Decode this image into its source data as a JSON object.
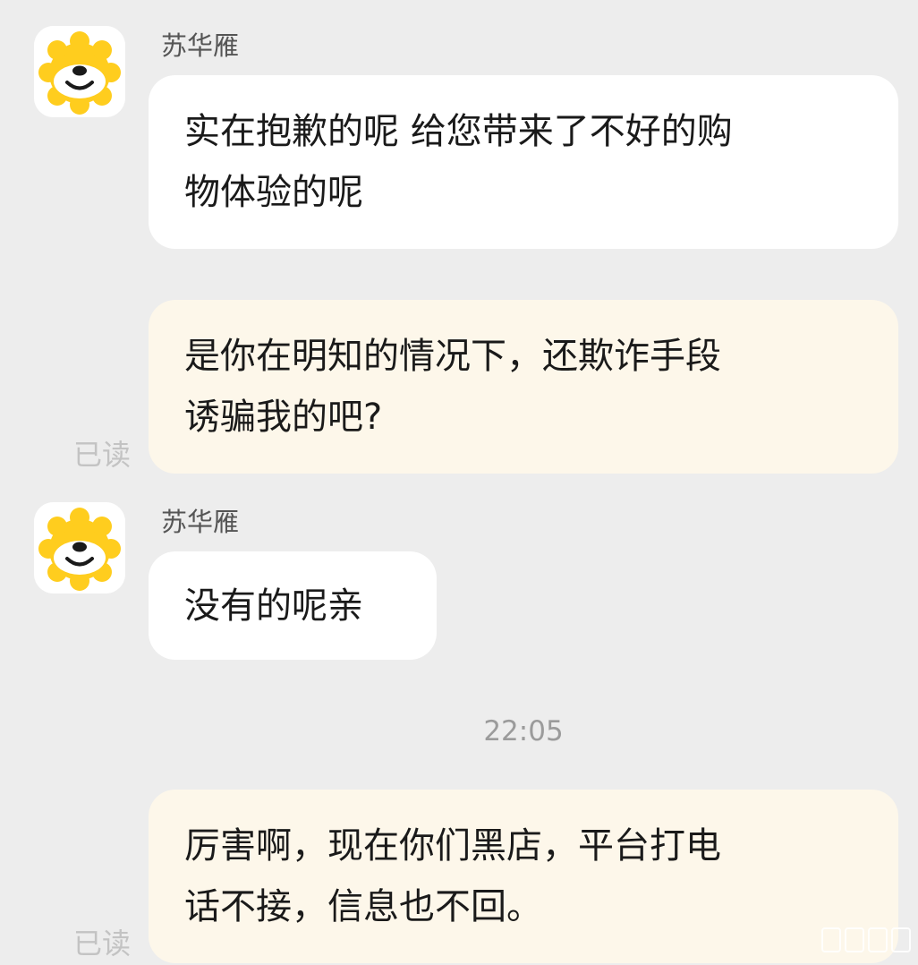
{
  "messages": [
    {
      "type": "incoming",
      "sender": "苏华雁",
      "text": "实在抱歉的呢 给您带来了不好的购\n物体验的呢",
      "avatar_icon": "lion-mascot-icon"
    },
    {
      "type": "outgoing",
      "text": "是你在明知的情况下，还欺诈手段\n诱骗我的吧?",
      "status": "已读"
    },
    {
      "type": "incoming",
      "sender": "苏华雁",
      "text": "没有的呢亲",
      "avatar_icon": "lion-mascot-icon"
    },
    {
      "type": "timestamp",
      "text": "22:05"
    },
    {
      "type": "outgoing",
      "text": "厉害啊，现在你们黑店，平台打电\n话不接，信息也不回。",
      "status": "已读"
    }
  ],
  "colors": {
    "background": "#ededed",
    "incoming_bubble": "#ffffff",
    "outgoing_bubble": "#fdf7ea",
    "mascot_yellow": "#ffcd1e",
    "read_status": "#c3c3c3",
    "timestamp": "#9b9b9b"
  }
}
